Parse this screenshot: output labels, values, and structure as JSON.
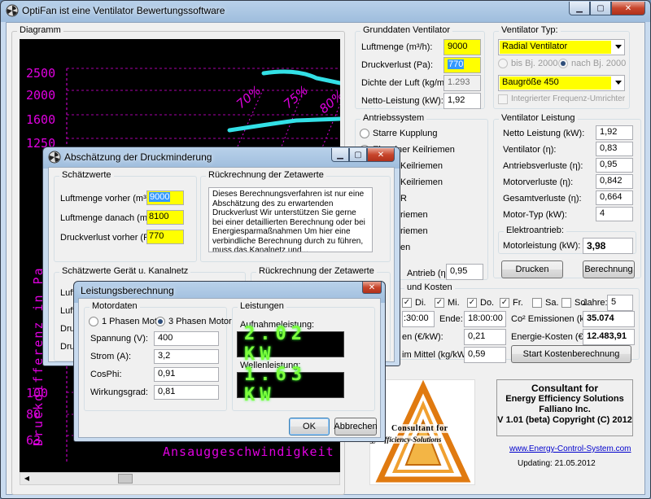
{
  "main_window": {
    "title": "OptiFan ist eine Ventilator Bewertungssoftware",
    "diagram_label": "Diagramm"
  },
  "chart_data": {
    "type": "line",
    "y_ticks": [
      "2500",
      "2000",
      "1600",
      "1250",
      "100",
      "80",
      "63"
    ],
    "efficiency_labels": [
      "70%",
      "75%",
      "80%"
    ],
    "ylabel": "Druckdifferenz in Pa",
    "xlabel": "Ansauggeschwindigkeit",
    "colors": {
      "grid": "#e000e0",
      "curve": "#33e0e6",
      "text": "#e000e0"
    }
  },
  "grunddaten": {
    "title": "Grunddaten Ventilator",
    "luftmenge_label": "Luftmenge (m³/h):",
    "luftmenge": "9000",
    "druckverlust_label": "Druckverlust (Pa):",
    "druckverlust": "770",
    "dichte_label": "Dichte der Luft (kg/m³):",
    "dichte": "1.293",
    "netto_label": "Netto-Leistung (kW):",
    "netto": "1,92"
  },
  "ventilator_typ": {
    "title": "Ventilator Typ:",
    "type_value": "Radial Ventilator",
    "bis_label": "bis Bj. 2000",
    "nach_label": "nach Bj. 2000",
    "groesse_value": "Baugröße 450",
    "fu_label": "Integrierter Frequenz-Umrichter"
  },
  "antriebssystem": {
    "title": "Antriebssystem",
    "options": [
      "Starre Kupplung",
      "Einzelner Keilriemen",
      "Keilriemen",
      "Keilriemen",
      "R",
      "riemen",
      "riemen",
      "en"
    ],
    "antrieb_label": "Antrieb (η):",
    "antrieb": "0,95"
  },
  "ventilator_leistung": {
    "title": "Ventilator Leistung",
    "rows": [
      {
        "label": "Netto Leistung (kW):",
        "value": "1,92"
      },
      {
        "label": "Ventilator (η):",
        "value": "0,83"
      },
      {
        "label": "Antriebsverluste (η):",
        "value": "0,95"
      },
      {
        "label": "Motorverluste (η):",
        "value": "0,842"
      },
      {
        "label": "Gesamtverluste (η):",
        "value": "0,664"
      },
      {
        "label": "Motor-Typ (kW):",
        "value": "4"
      }
    ],
    "elektro_title": "Elektroantrieb:",
    "motor_label": "Motorleistung (kW):",
    "motor_value": "3,98",
    "drucken": "Drucken",
    "berechnung": "Berechnung"
  },
  "kosten": {
    "title": "und Kosten",
    "days": [
      {
        "label": "Di.",
        "checked": true
      },
      {
        "label": "Mi.",
        "checked": true
      },
      {
        "label": "Do.",
        "checked": true
      },
      {
        "label": "Fr.",
        "checked": true
      },
      {
        "label": "Sa.",
        "checked": false
      },
      {
        "label": "So.",
        "checked": false
      }
    ],
    "jahre_label": "Jahre:",
    "jahre": "5",
    "start_time": ":30:00",
    "ende_label": "Ende:",
    "ende": "18:00:00",
    "co2_label": "Co² Emissionen (kg):",
    "co2": "35.074",
    "preis_label": "en (€/kW):",
    "preis": "0,21",
    "energie_label": "Energie-Kosten (€):",
    "energie": "12.483,91",
    "mittel_label": "im Mittel (kg/kW):",
    "mittel": "0,59",
    "start_btn": "Start Kostenberechnung"
  },
  "logo": {
    "line1": "Consultant for",
    "line2": "gy-Efficiency-Solutions",
    "colors": {
      "orange": "#e07a10",
      "dark": "#7a3f00"
    }
  },
  "company": {
    "lines": [
      "Consultant for",
      "Energy Efficiency Solutions",
      "Falliano Inc.",
      "V 1.01  (beta) Copyright (C) 2012"
    ],
    "url": "www.Energy-Control-System.com",
    "updating": "Updating: 21.05.2012"
  },
  "dialog_druck": {
    "title": "Abschätzung der Druckminderung",
    "schaetzwerte_title": "Schätzwerte",
    "rows": [
      {
        "label": "Luftmenge vorher (m³/h):",
        "value": "9000"
      },
      {
        "label": "Luftmenge danach (m³/h):",
        "value": "8100"
      },
      {
        "label": "Druckverlust vorher (Pa):",
        "value": "770"
      }
    ],
    "rueck_title": "Rückrechnung der Zetawerte",
    "rueck_text": "Dieses Berechnungsverfahren ist nur eine Abschätzung des zu erwartenden Druckverlust Wir unterstützen Sie gerne bei einer detaillierten Berechnung oder bei Energiesparmaßnahmen Um hier eine verbindliche Berechnung durch zu führen, muss das Kanalnetz und...",
    "geraet_title": "Schätzwerte Gerät u. Kanalnetz",
    "rueck2_title": "Rückrechnung der Zetawerte",
    "partial_rows": [
      "Luft",
      "Luft",
      "Druc",
      "Druc"
    ]
  },
  "dialog_leistung": {
    "title": "Leistungsberechnung",
    "motordaten_title": "Motordaten",
    "phase1": "1 Phasen Motor",
    "phase3": "3 Phasen Motor",
    "rows": [
      {
        "label": "Spannung (V):",
        "value": "400"
      },
      {
        "label": "Strom (A):",
        "value": "3,2"
      },
      {
        "label": "CosPhi:",
        "value": "0,91"
      },
      {
        "label": "Wirkungsgrad:",
        "value": "0,81"
      }
    ],
    "leistungen_title": "Leistungen",
    "aufnahme_label": "Aufnahmeleistung:",
    "aufnahme": "2.02 KW",
    "wellen_label": "Wellenleistung:",
    "wellen": "1.63 KW",
    "ok": "OK",
    "abbrechen": "Abbrechen"
  }
}
